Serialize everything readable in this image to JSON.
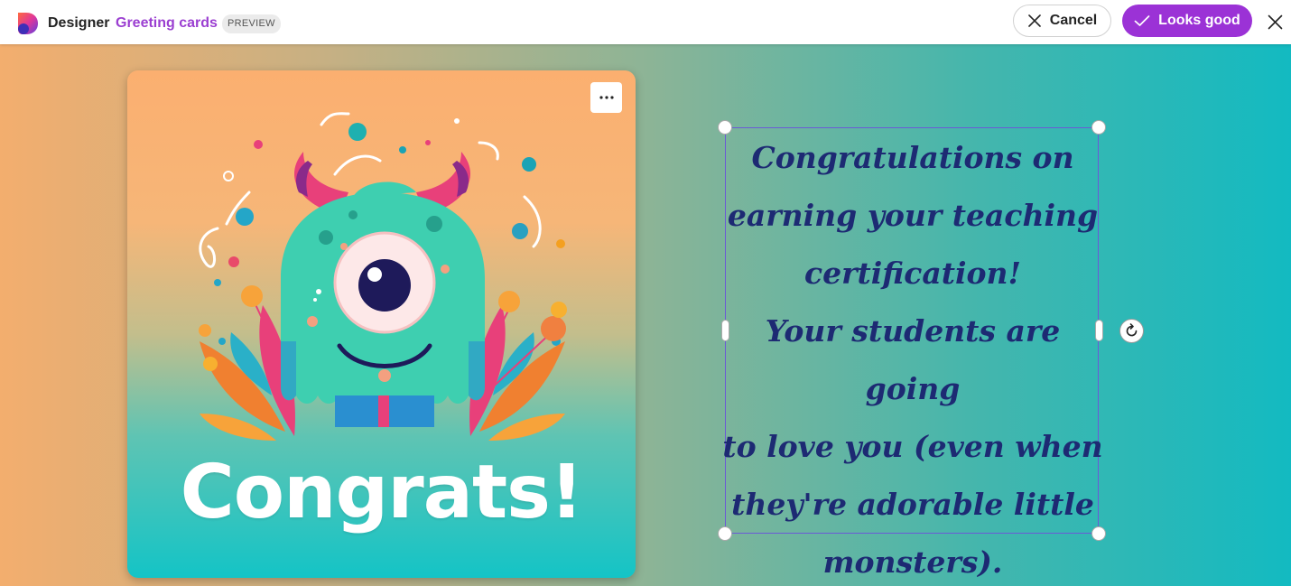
{
  "header": {
    "app_name": "Designer",
    "section": "Greeting cards",
    "badge": "PREVIEW",
    "cancel_label": "Cancel",
    "confirm_label": "Looks good",
    "accent_color": "#9b32d6"
  },
  "card": {
    "title": "Congrats!",
    "menu_icon": "more-horizontal-icon"
  },
  "message": {
    "lines": [
      "Congratulations on",
      "earning your teaching",
      "certification!",
      "Your students are going",
      "to love you (even when",
      "they're adorable little",
      "monsters)."
    ],
    "text_color": "#1d2a73"
  },
  "icons": {
    "cancel": "close-icon",
    "confirm": "checkmark-icon",
    "close": "close-icon",
    "rotate": "rotate-icon"
  }
}
